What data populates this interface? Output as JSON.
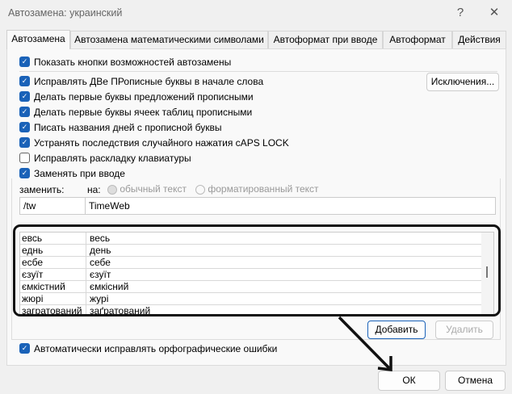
{
  "window": {
    "title": "Автозамена: украинский",
    "help": "?",
    "close": "✕"
  },
  "tabs": [
    {
      "label": "Автозамена",
      "active": true
    },
    {
      "label": "Автозамена математическими символами"
    },
    {
      "label": "Автоформат при вводе"
    },
    {
      "label": "Автоформат"
    },
    {
      "label": "Действия"
    }
  ],
  "options": [
    {
      "label": "Показать кнопки возможностей автозамены",
      "checked": true
    },
    {
      "label": "Исправлять ДВе ПРописные буквы в начале слова",
      "checked": true
    },
    {
      "label": "Делать первые буквы предложений прописными",
      "checked": true
    },
    {
      "label": "Делать первые буквы ячеек таблиц прописными",
      "checked": true
    },
    {
      "label": "Писать названия дней с прописной буквы",
      "checked": true
    },
    {
      "label": "Устранять последствия случайного нажатия cAPS LOCK",
      "checked": true
    },
    {
      "label": "Исправлять раскладку клавиатуры",
      "checked": false
    },
    {
      "label": "Заменять при вводе",
      "checked": true
    }
  ],
  "exceptions_button": "Исключения...",
  "replace": {
    "replace_label": "заменить:",
    "with_label": "на:",
    "plain_text": "обычный текст",
    "formatted_text": "форматированный текст",
    "replace_value": "/tw",
    "with_value": "TimeWeb"
  },
  "entries": [
    [
      "евсь",
      "весь"
    ],
    [
      "еднь",
      "день"
    ],
    [
      "есбе",
      "себе"
    ],
    [
      "єзуїт",
      "єзуїт"
    ],
    [
      "ємкістний",
      "ємкісний"
    ],
    [
      "жюрі",
      "журі"
    ],
    [
      "загратований",
      "заґратований"
    ]
  ],
  "add_button": "Добавить",
  "delete_button": "Удалить",
  "auto_spell": {
    "label": "Автоматически исправлять орфографические ошибки",
    "checked": true
  },
  "ok_button": "ОК",
  "cancel_button": "Отмена",
  "accent_color": "#1a62b8"
}
